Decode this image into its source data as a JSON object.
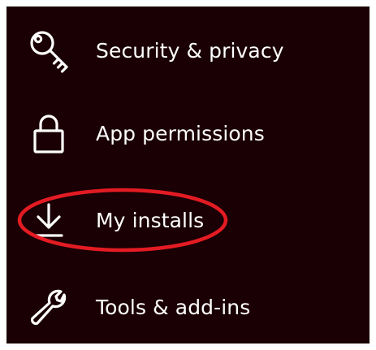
{
  "menu": {
    "items": [
      {
        "label": "Security & privacy",
        "icon": "key-icon"
      },
      {
        "label": "App permissions",
        "icon": "lock-icon"
      },
      {
        "label": "My installs",
        "icon": "download-icon"
      },
      {
        "label": "Tools & add-ins",
        "icon": "wrench-icon"
      }
    ]
  },
  "colors": {
    "background": "#1a0004",
    "text": "#ffffff",
    "highlight": "#e31b23"
  }
}
